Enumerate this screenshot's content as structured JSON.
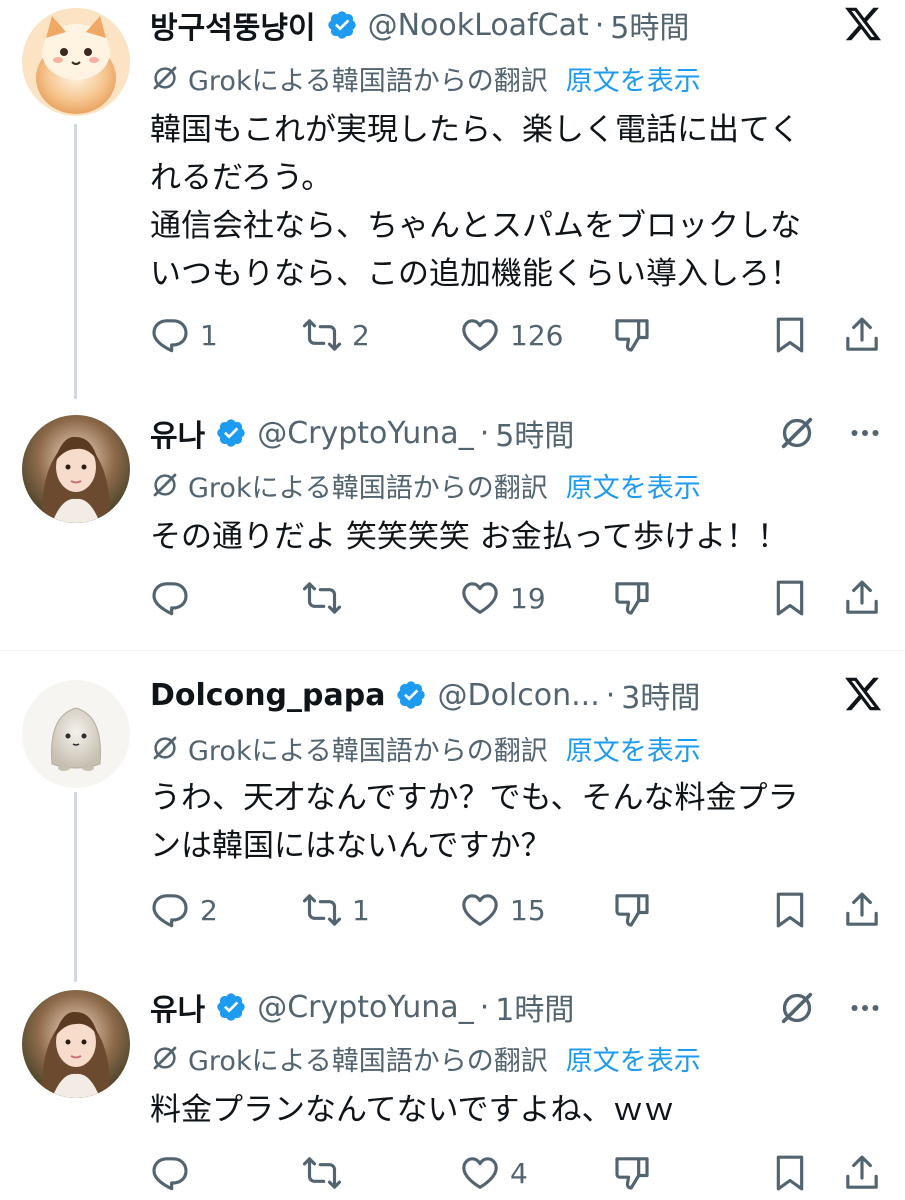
{
  "colors": {
    "accent": "#1d9bf0",
    "secondary_text": "#536471",
    "primary_text": "#0f1419"
  },
  "translation": {
    "label": "Grokによる韓国語からの翻訳",
    "show_original": "原文を表示"
  },
  "tweets": [
    {
      "name": "방구석뚱냥이",
      "handle": "@NookLoafCat",
      "separator": "·",
      "time": "5時間",
      "top_right_icon": "x-logo-icon",
      "text": "韓国もこれが実現したら、楽しく電話に出てく\nれるだろう。\n通信会社なら、ちゃんとスパムをブロックしな\nいつもりなら、この追加機能くらい導入しろ！",
      "replies": "1",
      "reposts": "2",
      "likes": "126"
    },
    {
      "name": "유나",
      "handle": "@CryptoYuna_",
      "separator": "·",
      "time": "5時間",
      "top_right_icon": "grok-icon",
      "text": "その通りだよ 笑笑笑笑 お金払って歩けよ！！",
      "replies": "",
      "reposts": "",
      "likes": "19"
    },
    {
      "name": "Dolcong_papa",
      "handle": "@Dolcon...",
      "separator": "·",
      "time": "3時間",
      "top_right_icon": "x-logo-icon",
      "text": "うわ、天才なんですか？でも、そんな料金プラ\nンは韓国にはないんですか？",
      "replies": "2",
      "reposts": "1",
      "likes": "15"
    },
    {
      "name": "유나",
      "handle": "@CryptoYuna_",
      "separator": "·",
      "time": "1時間",
      "top_right_icon": "grok-icon",
      "text": "料金プランなんてないですよね、ｗｗ",
      "replies": "",
      "reposts": "",
      "likes": "4"
    }
  ]
}
